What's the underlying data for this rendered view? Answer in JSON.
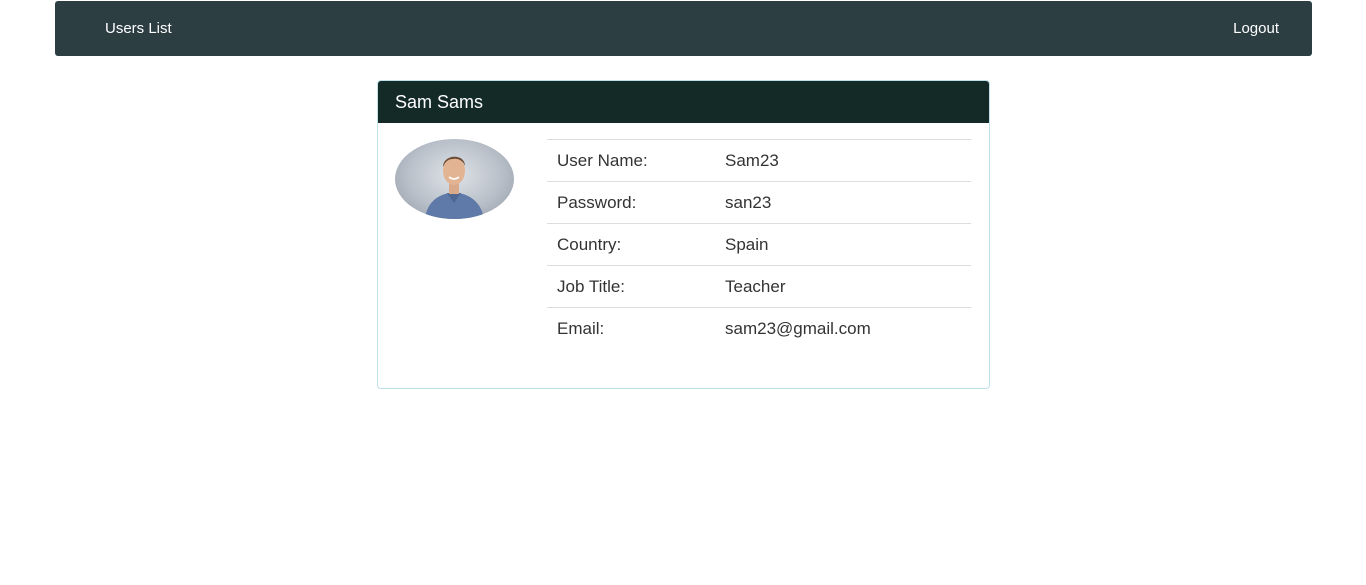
{
  "navbar": {
    "users_list": "Users List",
    "logout": "Logout"
  },
  "profile": {
    "name": "Sam Sams",
    "fields": [
      {
        "label": "User Name:",
        "value": "Sam23"
      },
      {
        "label": "Password:",
        "value": "san23"
      },
      {
        "label": "Country:",
        "value": "Spain"
      },
      {
        "label": "Job Title:",
        "value": "Teacher"
      },
      {
        "label": "Email:",
        "value": "sam23@gmail.com"
      }
    ]
  },
  "colors": {
    "navbar_bg": "#2c3e42",
    "panel_heading_bg": "#132a27",
    "panel_border": "#bfe1ea"
  }
}
